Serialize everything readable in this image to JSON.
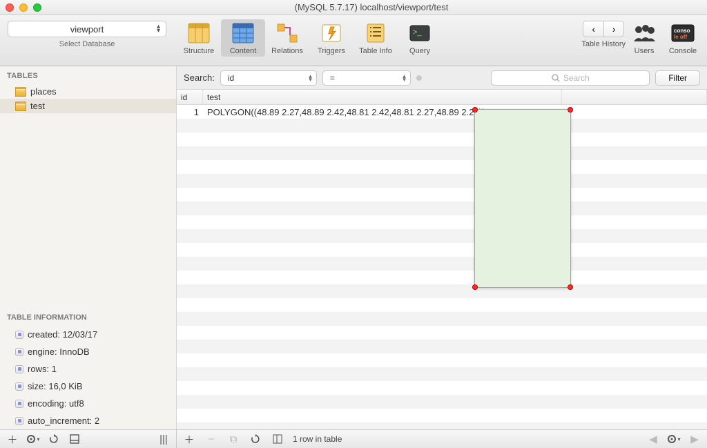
{
  "window": {
    "title": "(MySQL 5.7.17) localhost/viewport/test"
  },
  "toolbar": {
    "database_selected": "viewport",
    "database_sublabel": "Select Database",
    "tabs": {
      "structure": "Structure",
      "content": "Content",
      "relations": "Relations",
      "triggers": "Triggers",
      "table_info": "Table Info",
      "query": "Query"
    },
    "history_label": "Table History",
    "users_label": "Users",
    "console_label": "Console"
  },
  "sidebar": {
    "tables_header": "TABLES",
    "items": [
      {
        "name": "places"
      },
      {
        "name": "test"
      }
    ],
    "info_header": "TABLE INFORMATION",
    "info": [
      {
        "label": "created: 12/03/17"
      },
      {
        "label": "engine: InnoDB"
      },
      {
        "label": "rows: 1"
      },
      {
        "label": "size: 16,0 KiB"
      },
      {
        "label": "encoding: utf8"
      },
      {
        "label": "auto_increment: 2"
      }
    ]
  },
  "search": {
    "label": "Search:",
    "column": "id",
    "operator": "=",
    "placeholder": "Search",
    "filter_label": "Filter"
  },
  "grid": {
    "columns": {
      "id": "id",
      "test": "test"
    },
    "rows": [
      {
        "id": "1",
        "test": "POLYGON((48.89 2.27,48.89 2.42,48.81 2.42,48.81 2.27,48.89 2.27))"
      }
    ]
  },
  "status": {
    "row_count": "1 row in table"
  }
}
